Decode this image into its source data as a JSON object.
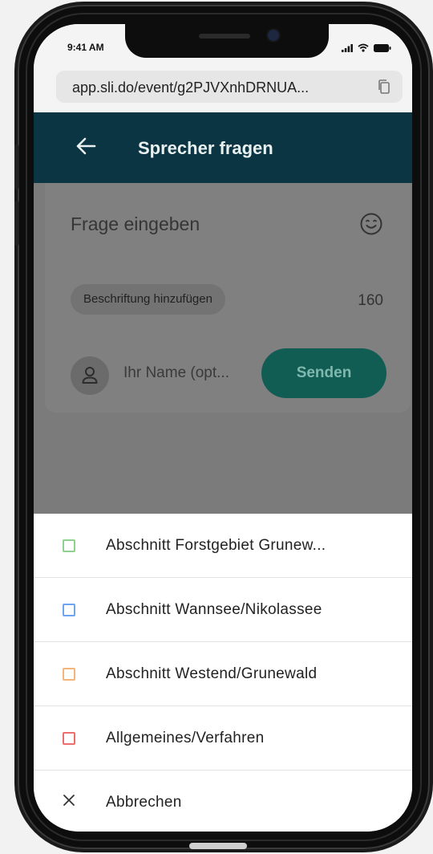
{
  "status": {
    "time": "9:41 AM"
  },
  "browser": {
    "url": "app.sli.do/event/g2PJVXnhDRNUA..."
  },
  "appbar": {
    "title": "Sprecher fragen"
  },
  "form": {
    "question_placeholder": "Frage eingeben",
    "label_chip": "Beschriftung hinzufügen",
    "char_count": "160",
    "name_placeholder": "Ihr Name (opt...",
    "send_label": "Senden"
  },
  "sheet": {
    "items": [
      {
        "label": "Abschnitt Forstgebiet Grunew...",
        "color": "#8fd08f"
      },
      {
        "label": "Abschnitt Wannsee/Nikolassee",
        "color": "#6fa4ef"
      },
      {
        "label": "Abschnitt Westend/Grunewald",
        "color": "#f3b57a"
      },
      {
        "label": "Allgemeines/Verfahren",
        "color": "#ec6e6e"
      }
    ],
    "cancel_label": "Abbrechen"
  },
  "colors": {
    "appbar": "#0b3542",
    "send_button": "#125d53",
    "overlay": "#7b7b7b"
  },
  "icons": [
    "signal-icon",
    "wifi-icon",
    "battery-icon",
    "copy-icon",
    "back-arrow-icon",
    "emoji-icon",
    "user-icon",
    "close-icon"
  ]
}
